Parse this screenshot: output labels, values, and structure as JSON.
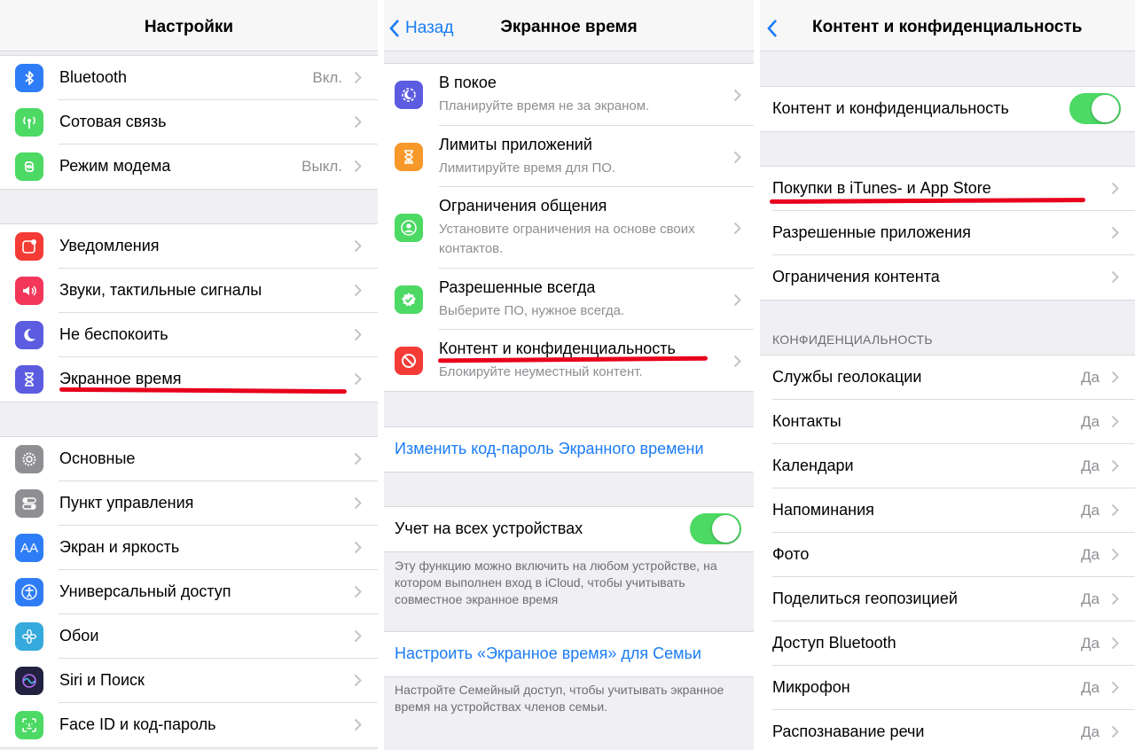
{
  "panel1": {
    "title": "Настройки",
    "group1": [
      {
        "label": "Bluetooth",
        "value": "Вкл.",
        "icon": "bluetooth-icon",
        "color": "#2f7df6"
      },
      {
        "label": "Сотовая связь",
        "value": "",
        "icon": "cellular-icon",
        "color": "#4cd964"
      },
      {
        "label": "Режим модема",
        "value": "Выкл.",
        "icon": "hotspot-icon",
        "color": "#4cd964"
      }
    ],
    "group2": [
      {
        "label": "Уведомления",
        "icon": "notifications-icon",
        "color": "#f43b35"
      },
      {
        "label": "Звуки, тактильные сигналы",
        "icon": "sounds-icon",
        "color": "#f2375a"
      },
      {
        "label": "Не беспокоить",
        "icon": "moon-icon",
        "color": "#5c5ce0"
      },
      {
        "label": "Экранное время",
        "icon": "hourglass-icon",
        "color": "#5c5ce0"
      }
    ],
    "group3": [
      {
        "label": "Основные",
        "icon": "gear-icon",
        "color": "#8e8e93"
      },
      {
        "label": "Пункт управления",
        "icon": "control-center-icon",
        "color": "#8e8e93"
      },
      {
        "label": "Экран и яркость",
        "icon": "display-icon",
        "color": "#2f7df6",
        "glyph": "AA"
      },
      {
        "label": "Универсальный доступ",
        "icon": "accessibility-icon",
        "color": "#2f7df6"
      },
      {
        "label": "Обои",
        "icon": "wallpaper-icon",
        "color": "#36aadc"
      },
      {
        "label": "Siri и Поиск",
        "icon": "siri-icon",
        "color": "#222240"
      },
      {
        "label": "Face ID и код-пароль",
        "icon": "faceid-icon",
        "color": "#4cd964"
      }
    ]
  },
  "panel2": {
    "back_label": "Назад",
    "title": "Экранное время",
    "items": [
      {
        "title": "В покое",
        "subtitle": "Планируйте время не за экраном.",
        "icon": "downtime-icon",
        "color": "#5c5ce0"
      },
      {
        "title": "Лимиты приложений",
        "subtitle": "Лимитируйте время для ПО.",
        "icon": "app-limits-icon",
        "color": "#f7982a"
      },
      {
        "title": "Ограничения общения",
        "subtitle": "Установите ограничения на основе своих контактов.",
        "icon": "communication-limits-icon",
        "color": "#4cd964"
      },
      {
        "title": "Разрешенные всегда",
        "subtitle": "Выберите ПО, нужное всегда.",
        "icon": "always-allowed-icon",
        "color": "#4cd964"
      },
      {
        "title": "Контент и конфиденциальность",
        "subtitle": "Блокируйте неуместный контент.",
        "icon": "restrictions-icon",
        "color": "#f43b35"
      }
    ],
    "change_passcode": "Изменить код-пароль Экранного времени",
    "share_across": {
      "label": "Учет на всех устройствах",
      "on": true
    },
    "share_note": "Эту функцию можно включить на любом устройстве, на котором выполнен вход в iCloud, чтобы учитывать совместное экранное время",
    "family_link": "Настроить «Экранное время» для Семьи",
    "family_note": "Настройте Семейный доступ, чтобы учитывать экранное время на устройствах членов семьи."
  },
  "panel3": {
    "title": "Контент и конфиденциальность",
    "toggle": {
      "label": "Контент и конфиденциальность",
      "on": true
    },
    "group": [
      {
        "label": "Покупки в iTunes- и App Store"
      },
      {
        "label": "Разрешенные приложения"
      },
      {
        "label": "Ограничения контента"
      }
    ],
    "privacy_header": "КОНФИДЕНЦИАЛЬНОСТЬ",
    "privacy": [
      {
        "label": "Службы геолокации",
        "value": "Да"
      },
      {
        "label": "Контакты",
        "value": "Да"
      },
      {
        "label": "Календари",
        "value": "Да"
      },
      {
        "label": "Напоминания",
        "value": "Да"
      },
      {
        "label": "Фото",
        "value": "Да"
      },
      {
        "label": "Поделиться геопозицией",
        "value": "Да"
      },
      {
        "label": "Доступ Bluetooth",
        "value": "Да"
      },
      {
        "label": "Микрофон",
        "value": "Да"
      },
      {
        "label": "Распознавание речи",
        "value": "Да"
      }
    ]
  },
  "colors": {
    "link": "#1a7cf5",
    "toggle_on": "#4cd964",
    "highlight": "#e8001c"
  }
}
